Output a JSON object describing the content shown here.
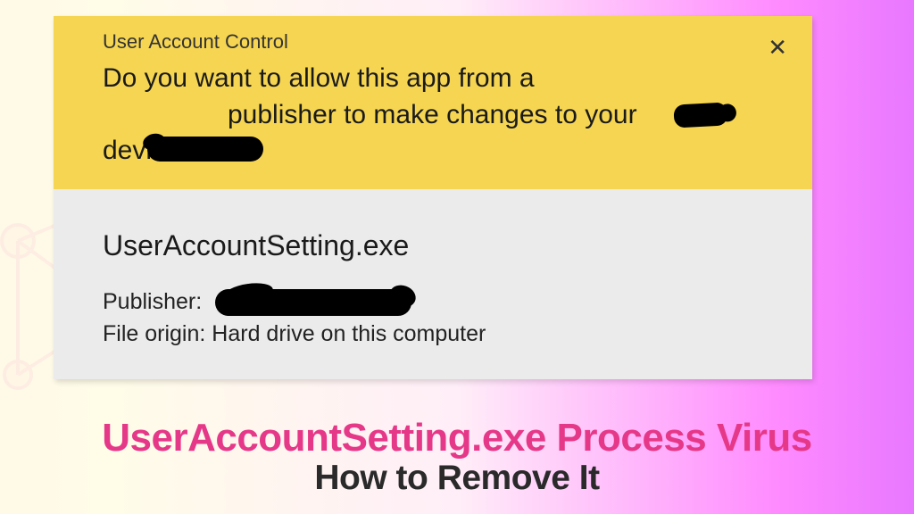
{
  "uac": {
    "title": "User Account Control",
    "question_line1": "Do you want to allow this app from a",
    "question_line2_after": "publisher to make changes to your",
    "question_line3": "device?",
    "app_name": "UserAccountSetting.exe",
    "publisher_label": "Publisher:",
    "file_origin_label": "File origin:",
    "file_origin_value": "Hard drive on this computer",
    "close": "✕"
  },
  "caption": {
    "title": "UserAccountSetting.exe Process Virus",
    "subtitle": "How to Remove It"
  }
}
